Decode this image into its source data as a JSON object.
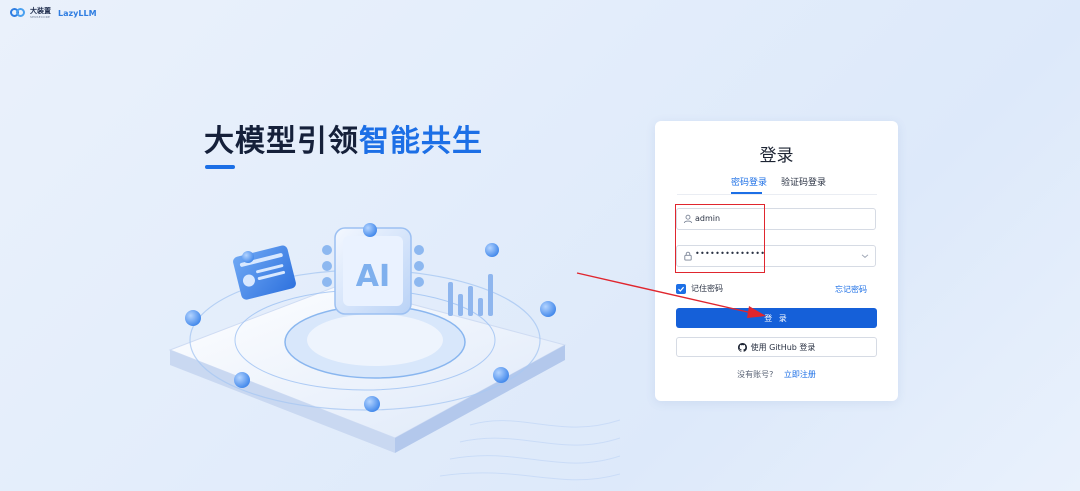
{
  "brand": {
    "name_cn": "大装置",
    "tagline": "SENSECORE",
    "product": "LazyLLM"
  },
  "hero": {
    "headline_dark": "大模型引领",
    "headline_blue": "智能共生",
    "illustration_text": "AI"
  },
  "login": {
    "title": "登录",
    "tabs": [
      {
        "label": "密码登录",
        "active": true
      },
      {
        "label": "验证码登录",
        "active": false
      }
    ],
    "username_value": "admin",
    "password_value": "••••••••••••••",
    "remember_label": "记住密码",
    "remember_checked": true,
    "forgot_label": "忘记密码",
    "submit_label": "登 录",
    "github_label": "使用 GitHub 登录",
    "no_account_label": "没有账号?",
    "signup_label": "立即注册"
  },
  "colors": {
    "accent": "#1c6fe6",
    "button": "#1560d9",
    "annotation": "#e0262e"
  },
  "icons": [
    "user-icon",
    "lock-icon",
    "chevron-down-icon",
    "check-icon",
    "github-icon"
  ]
}
